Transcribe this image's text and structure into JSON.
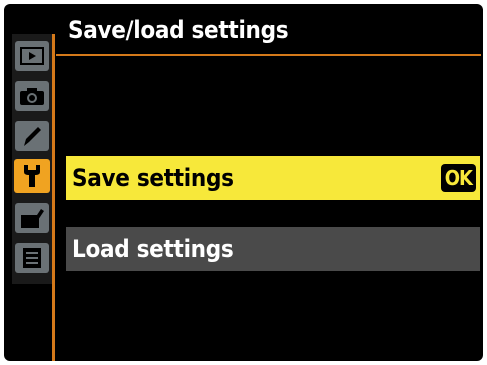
{
  "title": "Save/load settings",
  "sidebar": {
    "items": [
      {
        "icon": "playback-icon"
      },
      {
        "icon": "camera-icon"
      },
      {
        "icon": "pencil-icon"
      },
      {
        "icon": "wrench-icon",
        "active": true
      },
      {
        "icon": "retouch-icon"
      },
      {
        "icon": "my-menu-icon"
      }
    ]
  },
  "menu": {
    "items": [
      {
        "label": "Save settings",
        "badge": "OK",
        "selected": true
      },
      {
        "label": "Load settings",
        "selected": false
      }
    ]
  },
  "colors": {
    "accent": "#d4791a",
    "selected_bg": "#f7e83a",
    "row_bg": "#4a4a4a",
    "active_tab": "#f0a321"
  }
}
